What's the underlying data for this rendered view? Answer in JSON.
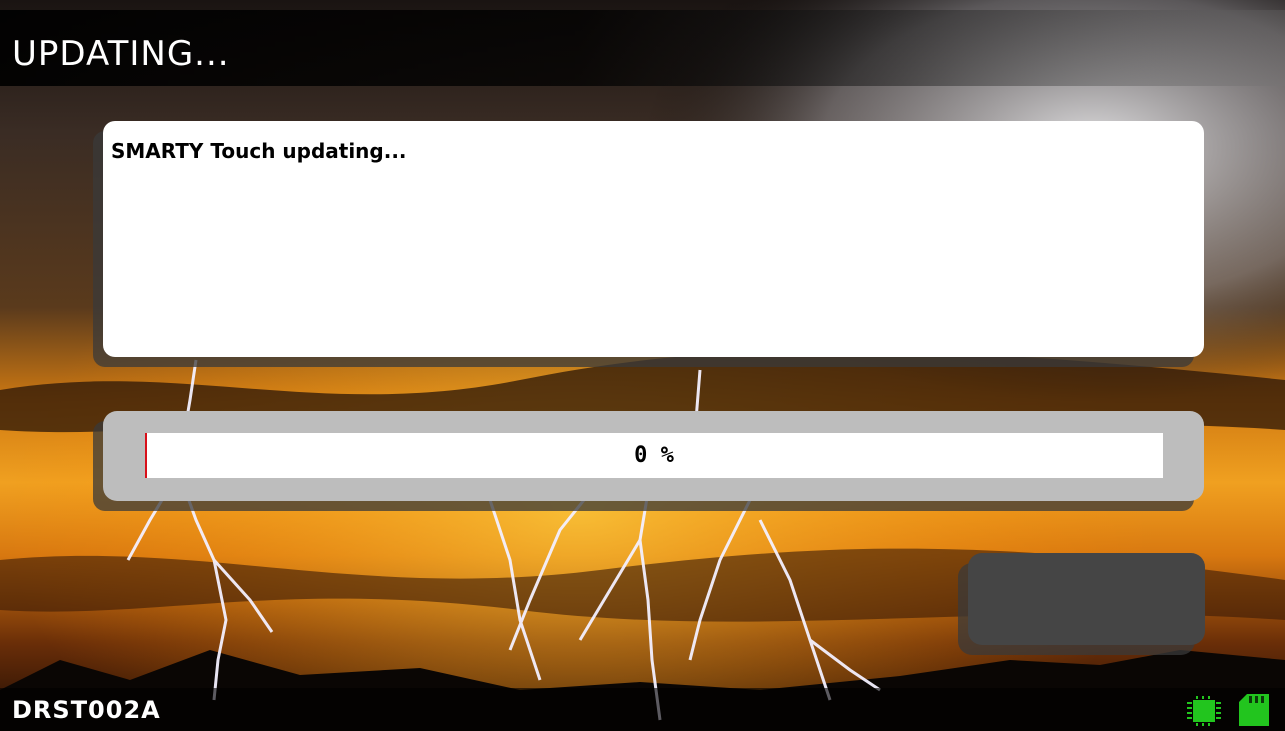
{
  "header": {
    "title": "UPDATING..."
  },
  "message_panel": {
    "text": "SMARTY Touch updating..."
  },
  "progress": {
    "value_percent": 0,
    "label": "0 %",
    "fill_color": "#d8101a"
  },
  "action_button": {
    "label": ""
  },
  "status_bar": {
    "device_id": "DRST002A",
    "icons": [
      "memory-chip-icon",
      "sd-card-icon"
    ],
    "icon_color": "#22c51e"
  },
  "colors": {
    "panel": "#ffffff",
    "progress_panel": "#bdbdbd",
    "button": "#454545"
  }
}
